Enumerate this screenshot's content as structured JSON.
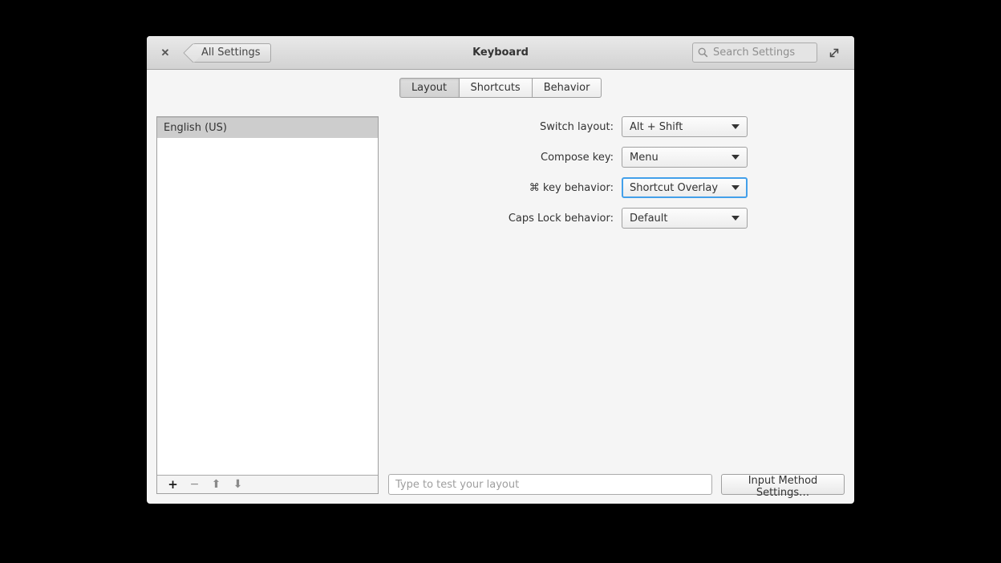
{
  "window": {
    "title": "Keyboard"
  },
  "header": {
    "back_label": "All Settings",
    "search_placeholder": "Search Settings"
  },
  "icons": {
    "close": "✕",
    "add": "+",
    "remove": "−",
    "move_up": "⬆",
    "move_down": "⬇"
  },
  "tabs": [
    {
      "label": "Layout",
      "active": true
    },
    {
      "label": "Shortcuts",
      "active": false
    },
    {
      "label": "Behavior",
      "active": false
    }
  ],
  "layout_list": {
    "items": [
      {
        "label": "English (US)",
        "selected": true
      }
    ]
  },
  "form": {
    "rows": [
      {
        "label": "Switch layout:",
        "value": "Alt + Shift",
        "focused": false
      },
      {
        "label": "Compose key:",
        "value": "Menu",
        "focused": false
      },
      {
        "label": "⌘ key behavior:",
        "value": "Shortcut Overlay",
        "focused": true
      },
      {
        "label": "Caps Lock behavior:",
        "value": "Default",
        "focused": false
      }
    ]
  },
  "footer": {
    "test_input_placeholder": "Type to test your layout",
    "input_method_button": "Input Method Settings…"
  },
  "colors": {
    "focus_border": "#43a0ea",
    "headerbar_top": "#e9e9e9",
    "headerbar_bottom": "#d2d2d2",
    "selected_row": "#cdcdcd",
    "content_bg": "#f5f5f5"
  }
}
